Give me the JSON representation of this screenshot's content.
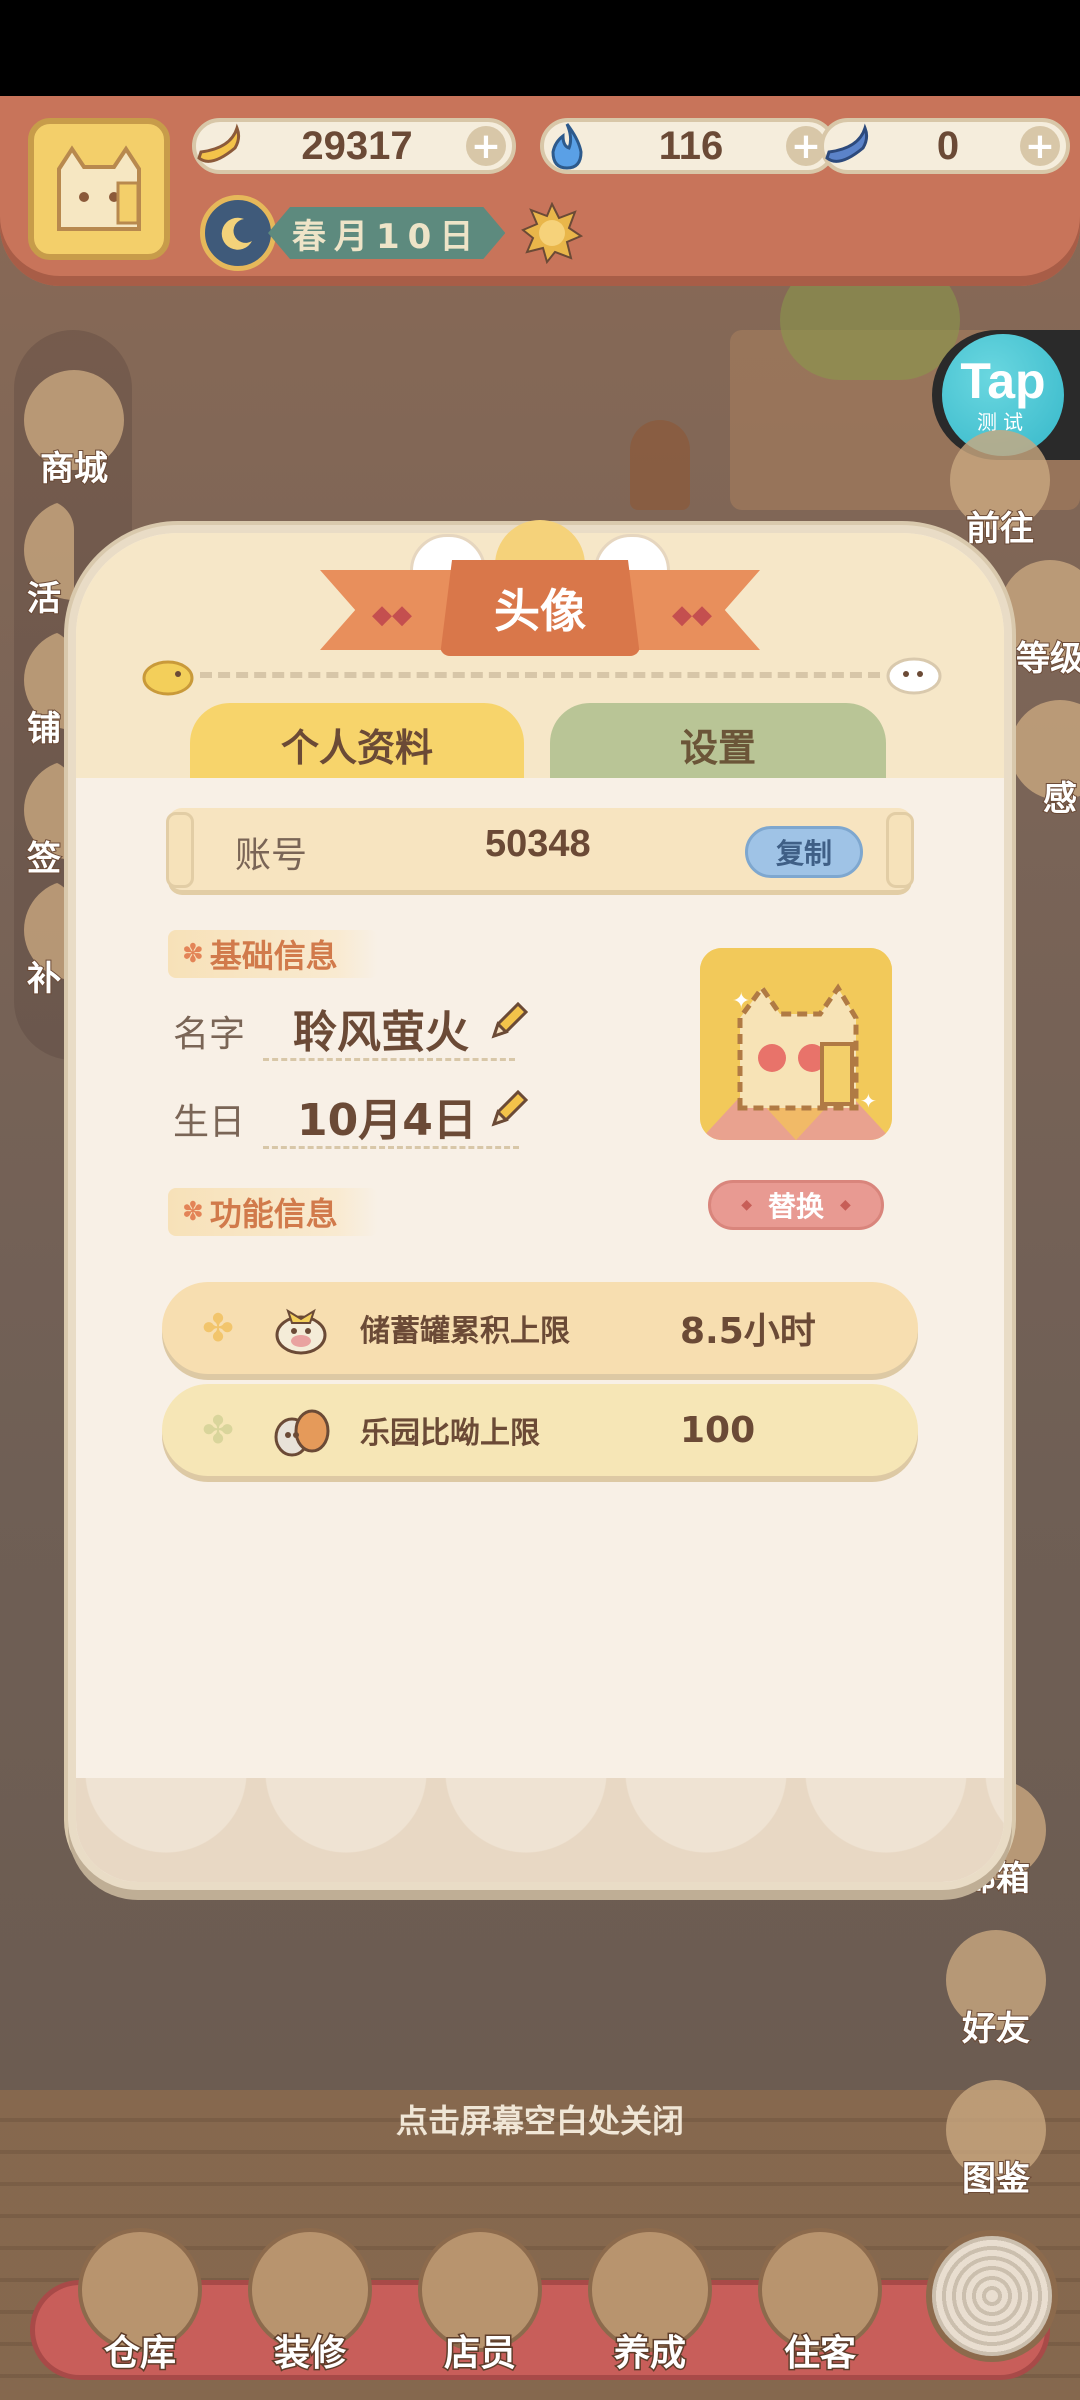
{
  "hud": {
    "bananas": "29317",
    "flames": "116",
    "blue_banana": "0",
    "date_text": "春月10日"
  },
  "side_left": [
    "商城",
    "活",
    "铺",
    "签",
    "补"
  ],
  "side_right": {
    "go_label": "前往",
    "level_label": "等级",
    "partial_label": "感",
    "mailbox": "邮箱",
    "friends": "好友",
    "collection": "图鉴"
  },
  "tap_badge": {
    "word": "Tap",
    "sub": "测试"
  },
  "modal": {
    "title": "头像",
    "tabs": {
      "profile": "个人资料",
      "settings": "设置"
    },
    "account": {
      "label": "账号",
      "value": "50348",
      "copy": "复制"
    },
    "basic_section": "基础信息",
    "name_label": "名字",
    "name_value": "聆风萤火",
    "birthday_label": "生日",
    "birthday_value": "10月4日",
    "replace": "替换",
    "function_section": "功能信息",
    "functions": [
      {
        "label": "储蓄罐累积上限",
        "value": "8.5小时"
      },
      {
        "label": "乐园比呦上限",
        "value": "100"
      }
    ]
  },
  "close_hint": "点击屏幕空白处关闭",
  "bottom_nav": [
    "仓库",
    "装修",
    "店员",
    "养成",
    "住客"
  ],
  "colors": {
    "ribbon": "#e88f5c",
    "tab_active": "#f7d46b",
    "tab_inactive": "#b9c596",
    "copy_button": "#9fc3e6",
    "replace_button": "#e89a92"
  }
}
